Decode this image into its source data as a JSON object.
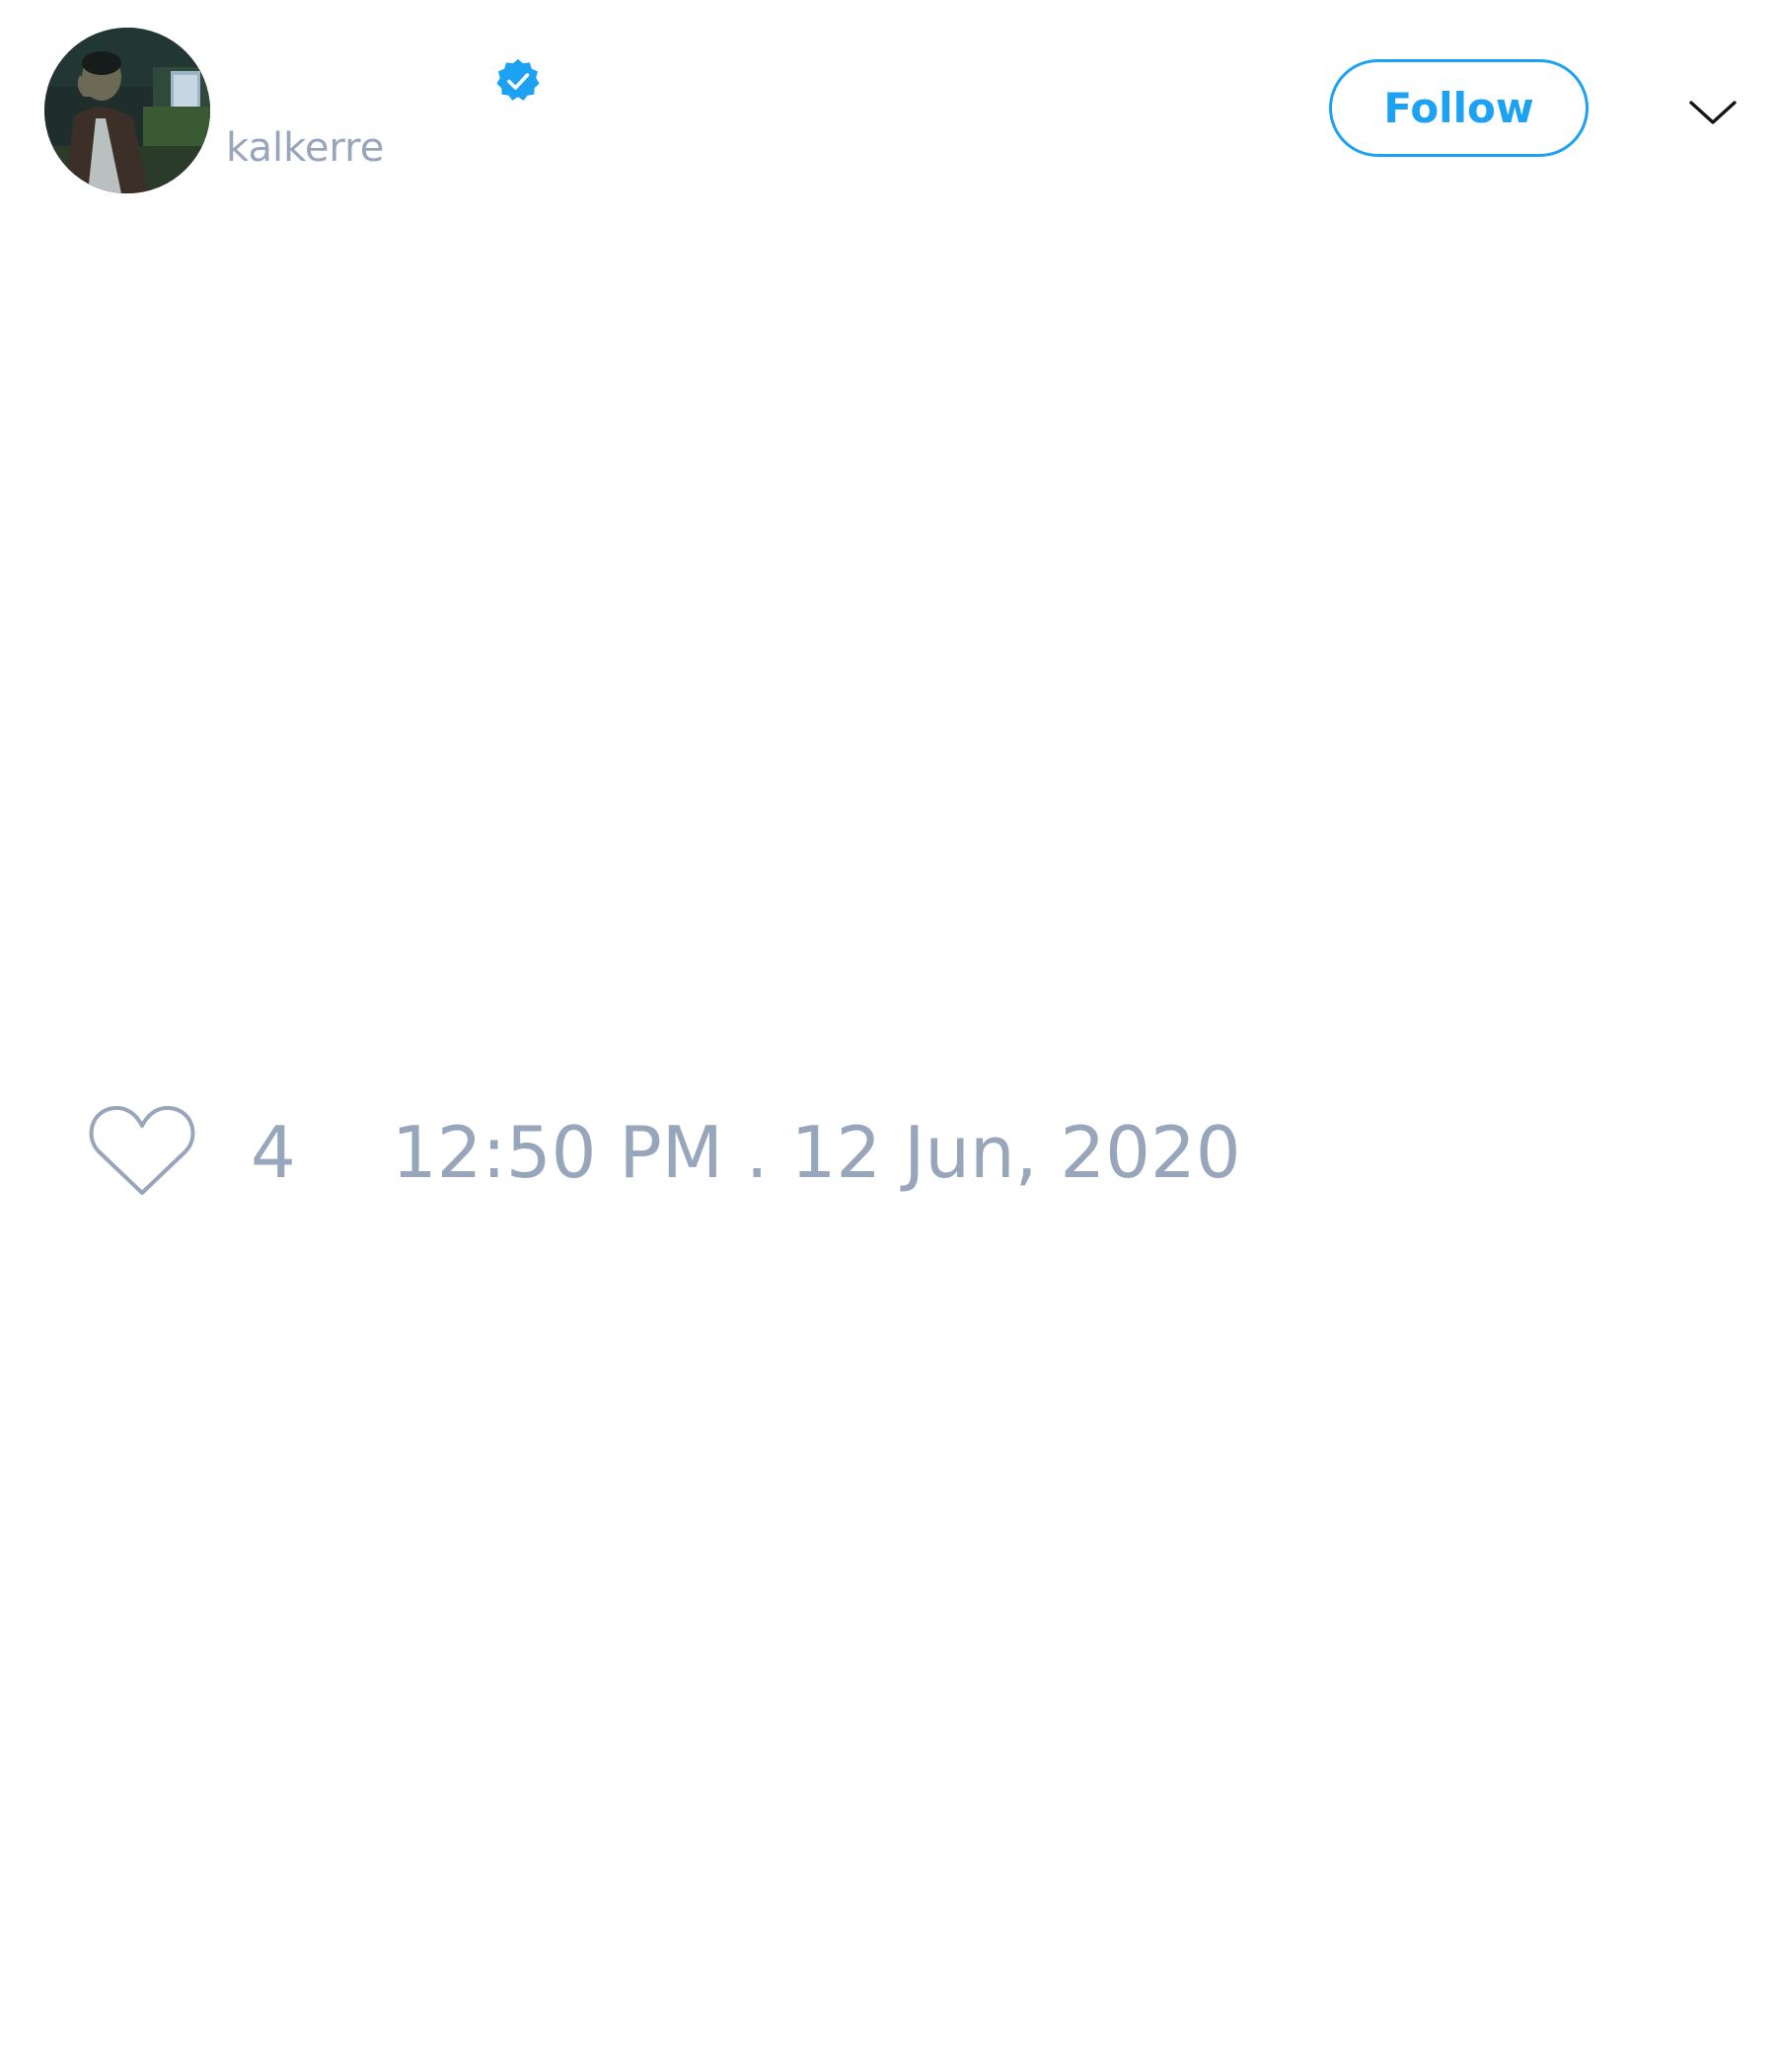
{
  "tweet": {
    "author": {
      "display_name": "",
      "handle": "kalkerre",
      "verified": true,
      "avatar_icon": "user-photo-avatar"
    },
    "follow_label": "Follow",
    "more_icon": "chevron-down-icon",
    "like_icon": "heart-outline-icon",
    "like_count": "4",
    "timestamp": "12:50 PM . 12 Jun, 2020"
  },
  "colors": {
    "accent": "#1da1f2",
    "secondary_text": "#97a6ba",
    "background": "#ffffff"
  }
}
